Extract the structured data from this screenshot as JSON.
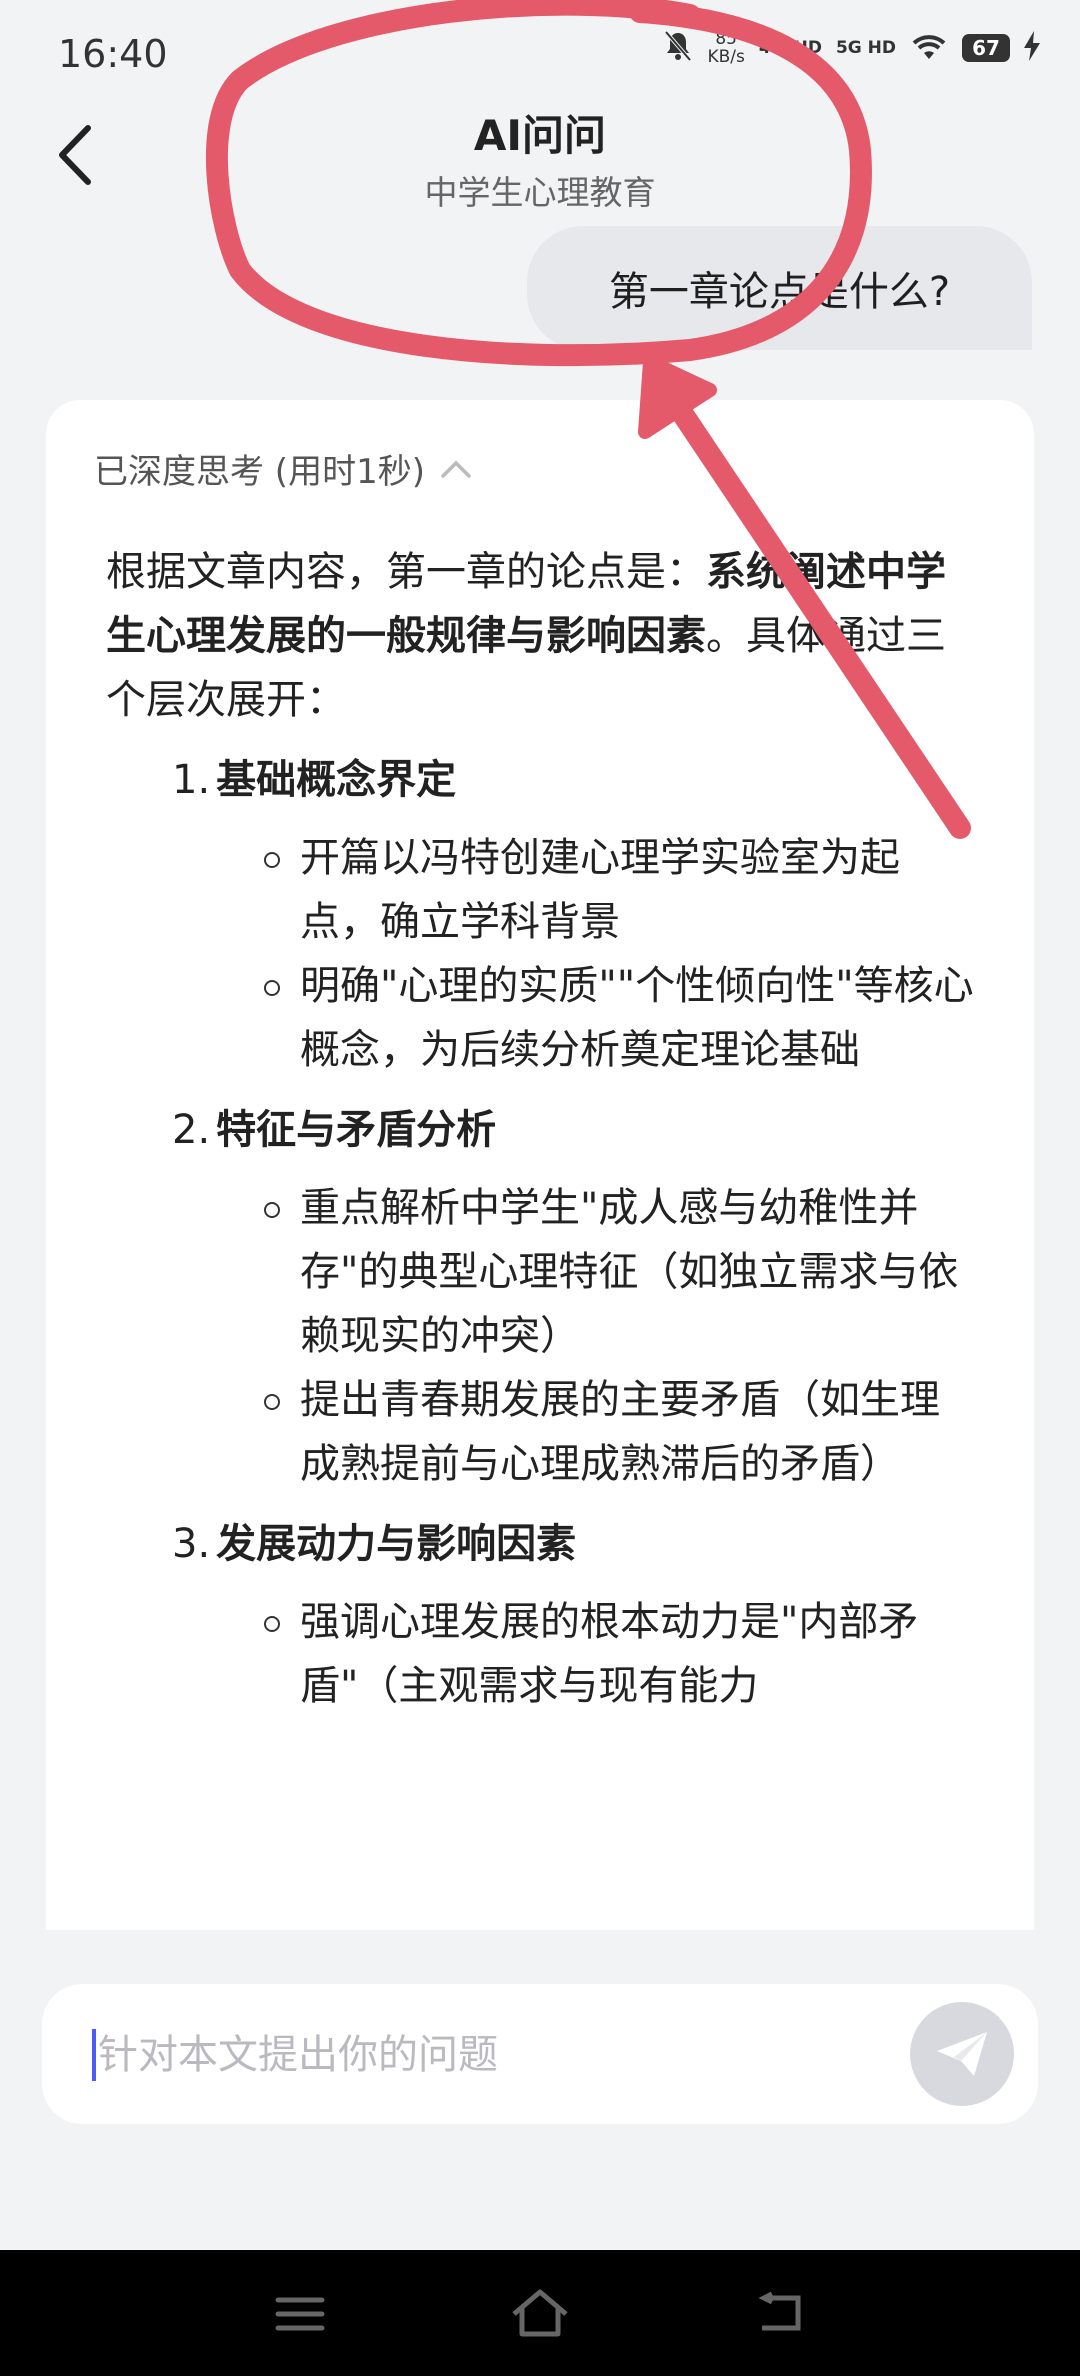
{
  "status_bar": {
    "time": "16:40",
    "net_speed_value": "85",
    "net_speed_unit": "KB/s",
    "signal_1": "4G⁺HD",
    "signal_2": "5G HD",
    "battery": "67"
  },
  "header": {
    "title": "AI问问",
    "subtitle": "中学生心理教育",
    "back_icon": "chevron-left-icon"
  },
  "user_message": "第一章论点是什么?",
  "answer": {
    "thinking_label": "已深度思考 (用时1秒)",
    "intro_prefix": "根据文章内容，第一章的论点是：",
    "intro_bold": "系统阐述中学生心理发展的一般规律与影响因素",
    "intro_suffix": "。具体通过三个层次展开：",
    "sections": [
      {
        "num": "1.",
        "title": "基础概念界定",
        "bullets": [
          "开篇以冯特创建心理学实验室为起点，确立学科背景",
          "明确\"心理的实质\"\"个性倾向性\"等核心概念，为后续分析奠定理论基础"
        ]
      },
      {
        "num": "2.",
        "title": "特征与矛盾分析",
        "bullets": [
          "重点解析中学生\"成人感与幼稚性并存\"的典型心理特征（如独立需求与依赖现实的冲突）",
          "提出青春期发展的主要矛盾（如生理成熟提前与心理成熟滞后的矛盾）"
        ]
      },
      {
        "num": "3.",
        "title": "发展动力与影响因素",
        "bullets": [
          "强调心理发展的根本动力是\"内部矛盾\"（主观需求与现有能力"
        ]
      }
    ]
  },
  "composer": {
    "placeholder": "针对本文提出你的问题",
    "send_icon": "paper-plane-icon"
  },
  "nav": {
    "menu_icon": "menu-icon",
    "home_icon": "home-icon",
    "back_icon": "back-icon"
  },
  "colors": {
    "annotation": "#e45a6a",
    "caret": "#4b5bff",
    "send_button": "#d7d9de"
  }
}
